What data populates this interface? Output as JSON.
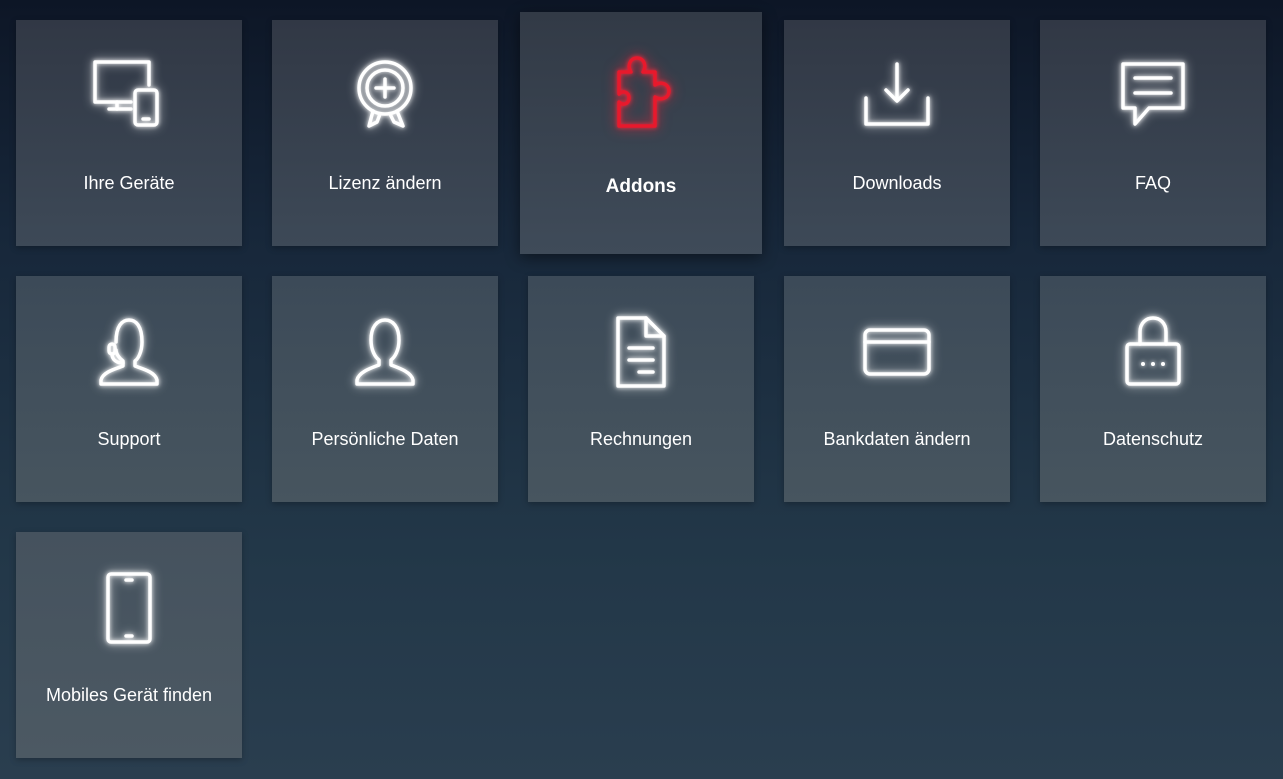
{
  "tiles": [
    {
      "label": "Ihre Geräte",
      "icon": "devices-icon"
    },
    {
      "label": "Lizenz ändern",
      "icon": "license-award-icon"
    },
    {
      "label": "Addons",
      "icon": "puzzle-icon",
      "active": true
    },
    {
      "label": "Downloads",
      "icon": "download-icon"
    },
    {
      "label": "FAQ",
      "icon": "chat-bubble-icon"
    },
    {
      "label": "Support",
      "icon": "headset-icon"
    },
    {
      "label": "Persönliche Daten",
      "icon": "user-icon"
    },
    {
      "label": "Rechnungen",
      "icon": "document-icon"
    },
    {
      "label": "Bankdaten ändern",
      "icon": "credit-card-icon"
    },
    {
      "label": "Datenschutz",
      "icon": "lock-icon"
    },
    {
      "label": "Mobiles Gerät finden",
      "icon": "tablet-icon"
    }
  ],
  "colors": {
    "icon_default": "#ffffff",
    "icon_active": "#e8192c",
    "background_top": "#0d1626",
    "background_bottom": "#2a3e4f"
  }
}
